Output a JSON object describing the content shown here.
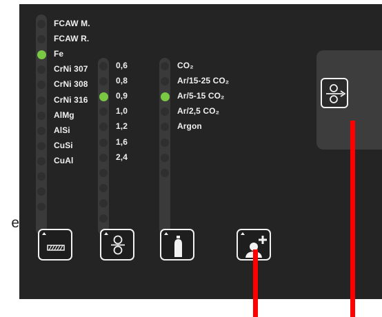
{
  "cut_label": "e",
  "wire_material": {
    "items": [
      "FCAW M.",
      "FCAW R.",
      "Fe",
      "CrNi 307",
      "CrNi 308",
      "CrNi 316",
      "AlMg",
      "AlSi",
      "CuSi",
      "CuAl"
    ],
    "selected": "Fe"
  },
  "wire_diameter": {
    "items": [
      "0,6",
      "0,8",
      "0,9",
      "1,0",
      "1,2",
      "1,6",
      "2,4"
    ],
    "selected": "0,9"
  },
  "gas": {
    "items": [
      "CO₂",
      "Ar/15-25 CO₂",
      "Ar/5-15 CO₂",
      "Ar/2,5 CO₂",
      "Argon"
    ],
    "selected": "Ar/5-15 CO₂"
  },
  "buttons": {
    "wire_material": "wire-spool-icon",
    "wire_diameter": "drive-rolls-icon",
    "gas": "gas-cylinder-icon",
    "add_user": "add-user-icon",
    "wire_feed": "wire-feed-icon"
  },
  "colors": {
    "active_dot": "#7ac943",
    "panel_bg": "#242424",
    "marker": "#ff0000"
  }
}
